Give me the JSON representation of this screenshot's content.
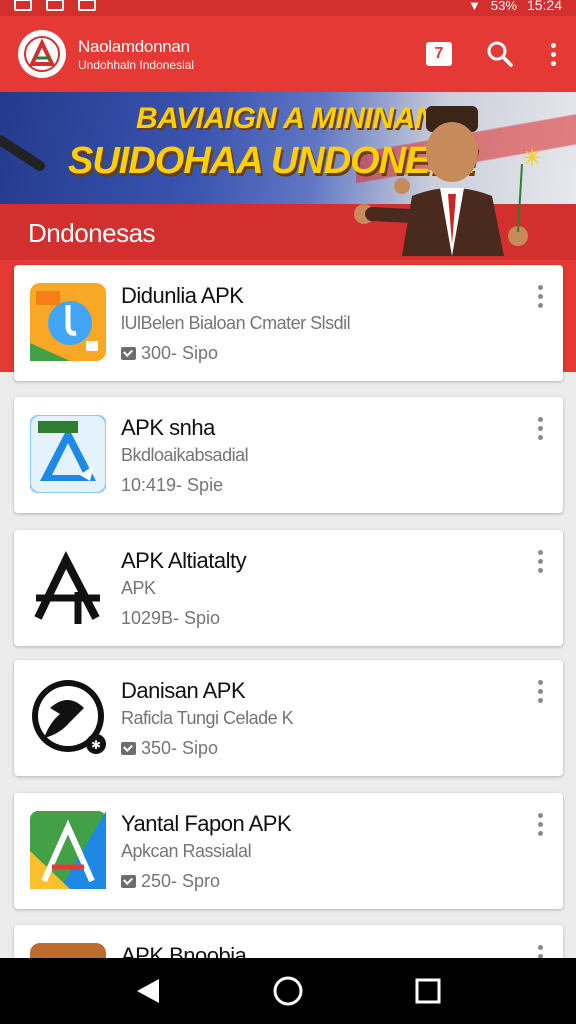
{
  "status_bar": {
    "battery": "53%",
    "time": "15:24"
  },
  "app_bar": {
    "title": "Naolamdonnan",
    "subtitle": "Undohhaln Indonesial",
    "calendar_label": "7"
  },
  "banner": {
    "line1": "BAVIAIGN A MININAN",
    "line2": "SUIDOHAA UNDONEIA!"
  },
  "section": {
    "title": "Dndonesas"
  },
  "apps": [
    {
      "title": "Didunlia APK",
      "subtitle": "lUlBelen Bialoan Cmater Slsdil",
      "size": "300- Sipo",
      "show_icon": true
    },
    {
      "title": "APK snha",
      "subtitle": "Bkdloaikabsadial",
      "size": "10:419- Spie",
      "show_icon": false
    },
    {
      "title": "APK Altiatalty",
      "subtitle": "APK",
      "size": "1029B- Spio",
      "show_icon": false
    },
    {
      "title": "Danisan APK",
      "subtitle": "Raficla Tungi Celade K",
      "size": "350- Sipo",
      "show_icon": true
    },
    {
      "title": "Yantal Fapon APK",
      "subtitle": "Apkcan Rassialal",
      "size": "250- Spro",
      "show_icon": true
    },
    {
      "title": "APK Bnoobia",
      "subtitle": "",
      "size": "",
      "show_icon": false
    }
  ],
  "colors": {
    "primary": "#e53935",
    "primary_dark": "#d32f2f",
    "banner_text": "#ffd000"
  },
  "icons": [
    "search-icon",
    "calendar-icon",
    "more-vert-icon",
    "back-icon",
    "home-icon",
    "recents-icon"
  ]
}
